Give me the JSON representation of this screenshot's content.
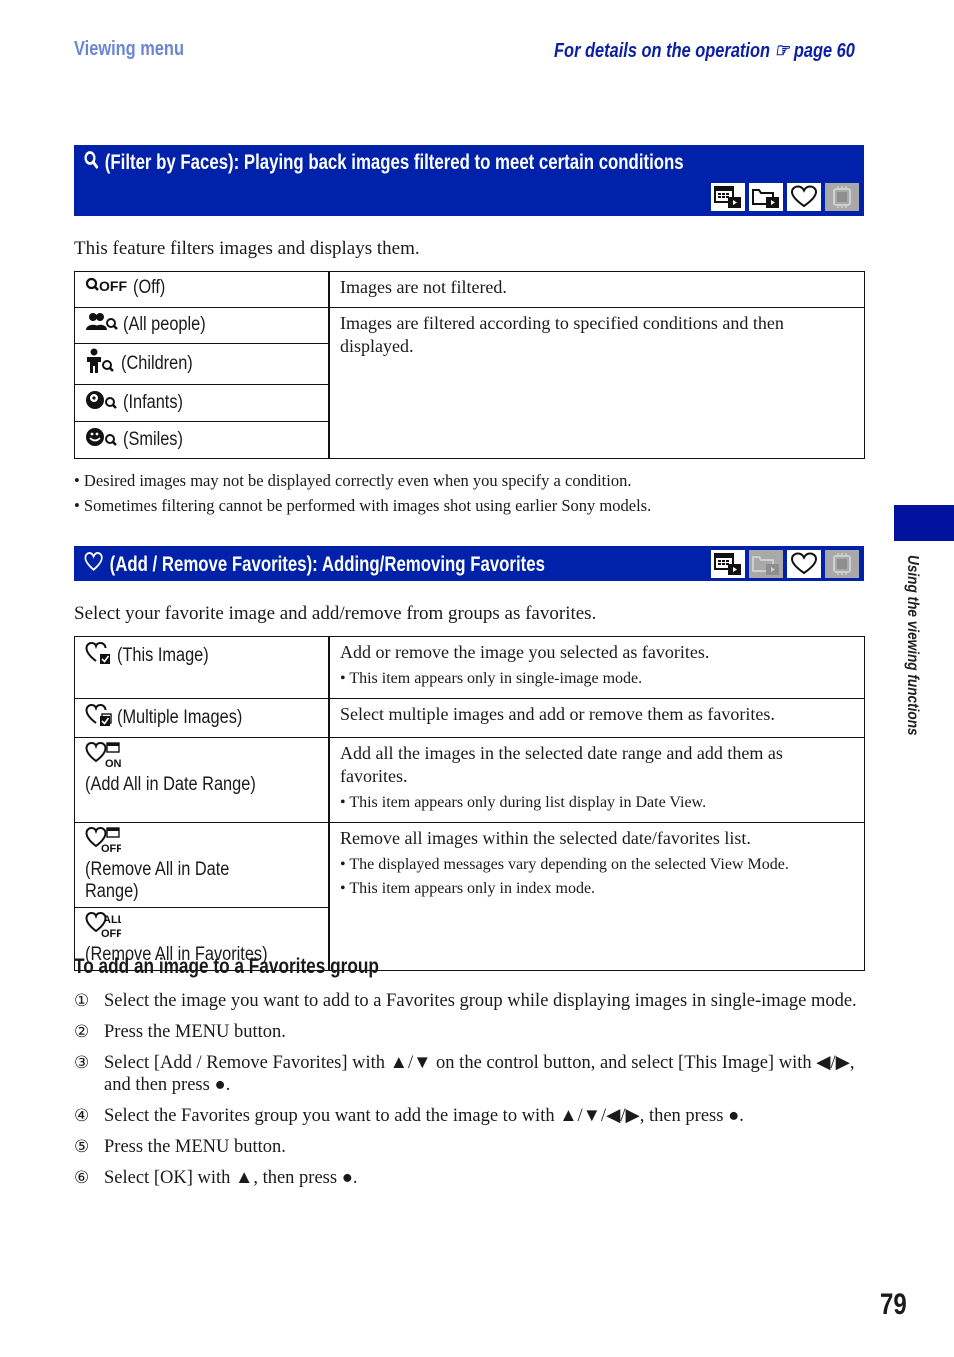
{
  "header": {
    "section": "Viewing menu",
    "details_prefix": "For details on the operation",
    "pointer_icon": "pointing-hand-icon",
    "details_page": "page 60"
  },
  "filter_section": {
    "title": "(Filter by Faces): Playing back images filtered to meet certain conditions",
    "title_icon": "magnifier-icon",
    "mode_icons": [
      {
        "name": "date-view-icon",
        "enabled": true
      },
      {
        "name": "folder-view-icon",
        "enabled": true
      },
      {
        "name": "favorites-heart-icon",
        "enabled": true
      },
      {
        "name": "internal-memory-icon",
        "enabled": false
      }
    ],
    "intro": "This feature filters images and displays them.",
    "options": [
      {
        "icon": "face-filter-off-icon",
        "label": "(Off)"
      },
      {
        "icon": "all-people-icon",
        "label": "(All people)"
      },
      {
        "icon": "children-icon",
        "label": "(Children)"
      },
      {
        "icon": "infants-icon",
        "label": "(Infants)"
      },
      {
        "icon": "smiles-icon",
        "label": "(Smiles)"
      }
    ],
    "descriptions": [
      "Images are not filtered.",
      "Images are filtered according to specified conditions and then displayed."
    ],
    "notes": [
      "Desired images may not be displayed correctly even when you specify a condition.",
      "Sometimes filtering cannot be performed with images shot using earlier Sony models."
    ]
  },
  "favorites_section": {
    "title": "(Add / Remove Favorites): Adding/Removing Favorites",
    "title_icon": "heart-icon",
    "mode_icons": [
      {
        "name": "date-view-icon",
        "enabled": true
      },
      {
        "name": "folder-view-icon",
        "enabled": false
      },
      {
        "name": "favorites-heart-icon",
        "enabled": true
      },
      {
        "name": "internal-memory-icon",
        "enabled": false
      }
    ],
    "intro": "Select your favorite image and add/remove from groups as favorites.",
    "rows": [
      {
        "icon": "heart-this-image-icon",
        "label": "(This Image)",
        "desc": "Add or remove the image you selected as favorites.",
        "notes": [
          "This item appears only in single-image mode."
        ]
      },
      {
        "icon": "heart-multiple-images-icon",
        "label": "(Multiple Images)",
        "desc": "Select multiple images and add or remove them as favorites.",
        "notes": []
      },
      {
        "icon": "heart-date-on-icon",
        "label": "(Add All in Date Range)",
        "desc": "Add all the images in the selected date range and add them as favorites.",
        "notes": [
          "This item appears only during list display in Date View."
        ]
      },
      {
        "icon": "heart-date-off-icon",
        "label": "(Remove All in Date Range)",
        "desc": "Remove all images within the selected date/favorites list.",
        "notes": [
          "The displayed messages vary depending on the selected View Mode.",
          "This item appears only in index mode."
        ]
      },
      {
        "icon": "heart-all-off-icon",
        "label": "(Remove All in Favorites)"
      }
    ]
  },
  "procedure": {
    "title": "To add an image to a Favorites group",
    "steps": [
      {
        "num": "①",
        "text": "Select the image you want to add to a Favorites group while displaying images in single-image mode."
      },
      {
        "num": "②",
        "text": "Press the MENU button."
      },
      {
        "num": "③",
        "text": "Select [Add / Remove Favorites] with ▲/▼ on the control button, and select [This Image] with ◀/▶, and then press ●."
      },
      {
        "num": "④",
        "text": "Select the Favorites group you want to add the image to with ▲/▼/◀/▶, then press ●."
      },
      {
        "num": "⑤",
        "text": "Press the MENU button."
      },
      {
        "num": "⑥",
        "text": "Select [OK] with ▲, then press ●."
      }
    ]
  },
  "side_tab": {
    "label": "Using the viewing functions",
    "color": "#00129e"
  },
  "page_number": "79",
  "colors": {
    "banner": "#0022aa",
    "header_left": "#6b85d4",
    "header_right": "#0b1fa6"
  }
}
